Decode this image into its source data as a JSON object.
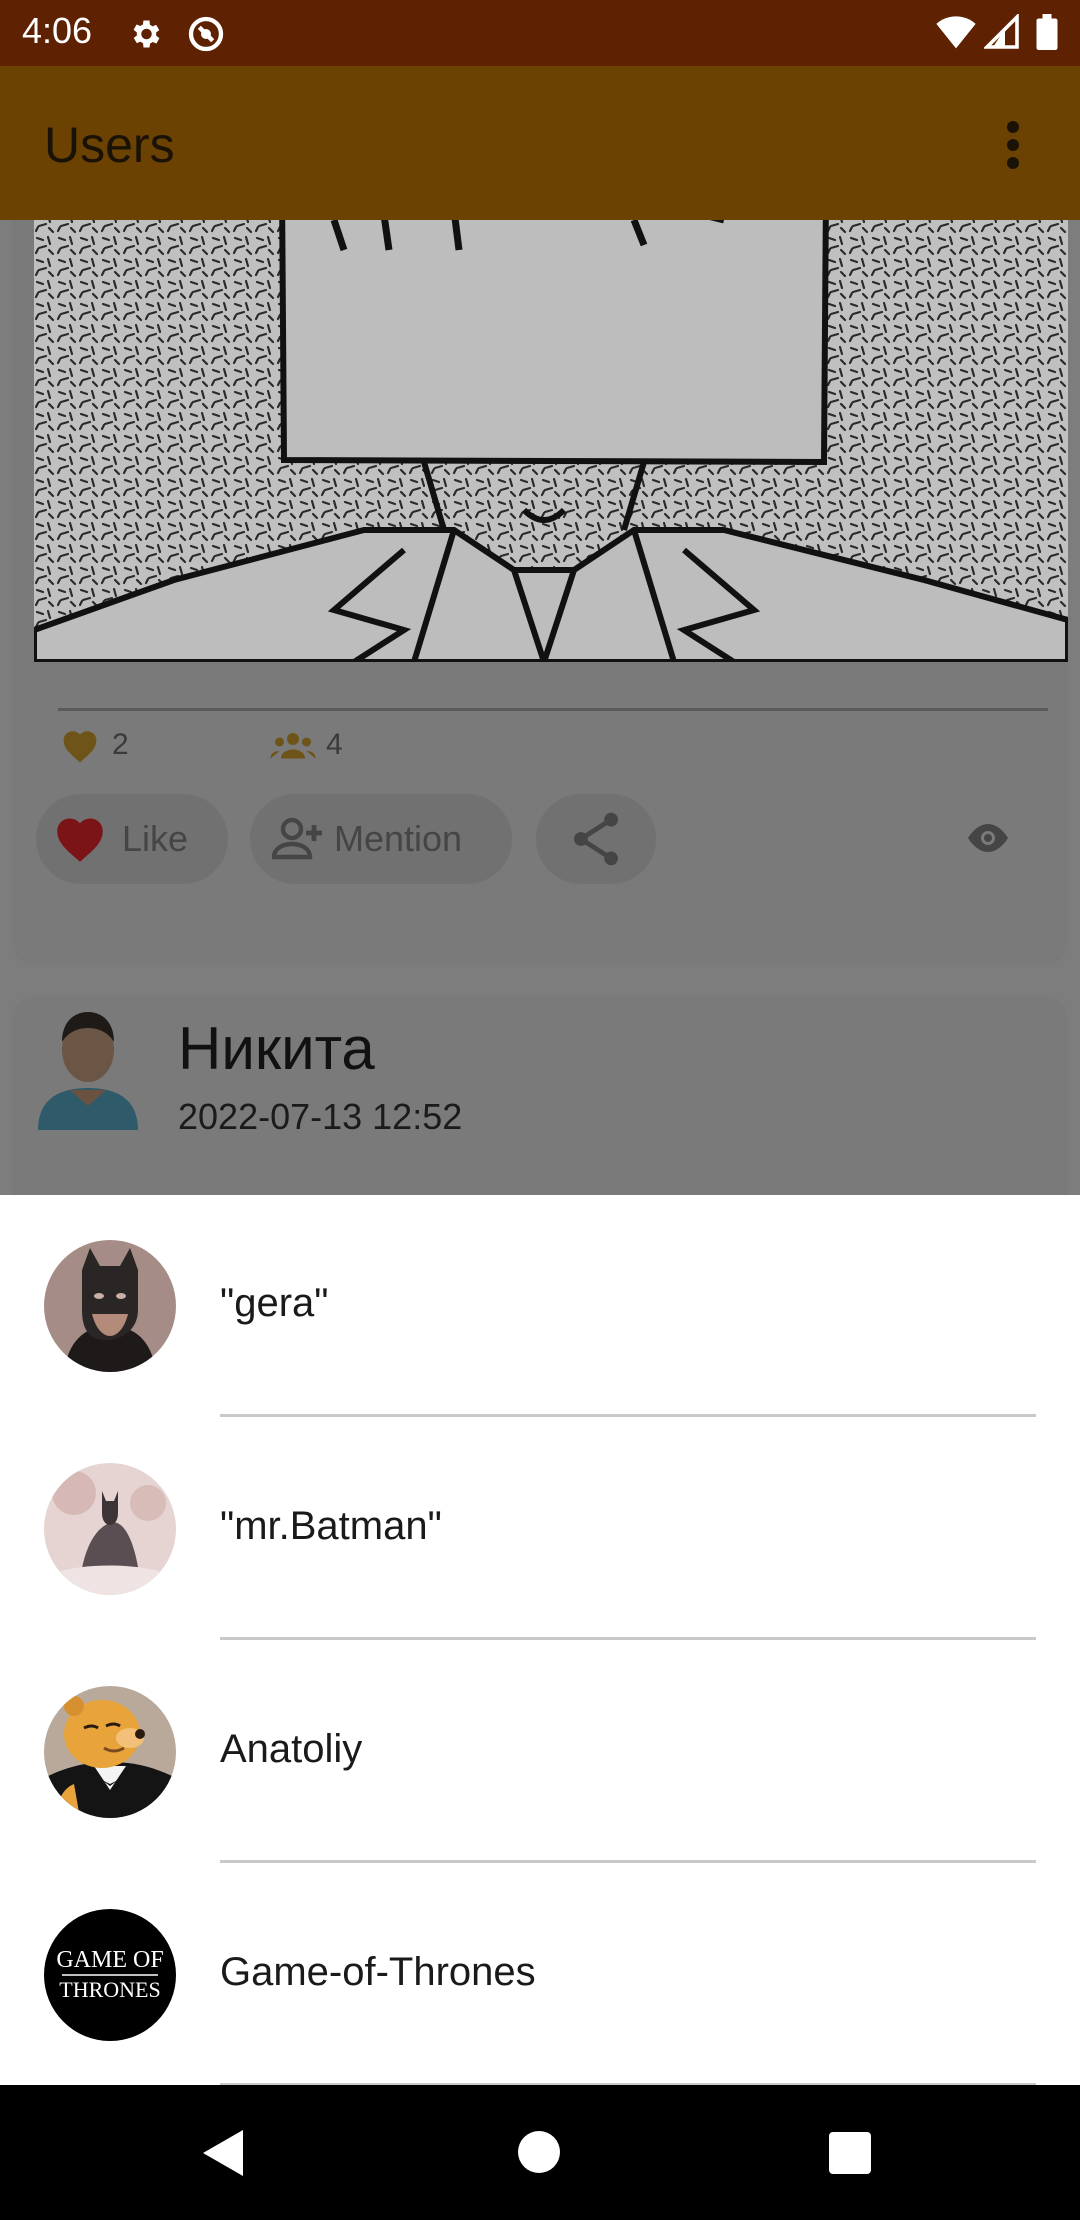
{
  "status_bar": {
    "time": "4:06",
    "icons": [
      "gear-icon",
      "vpn-icon",
      "wifi-icon",
      "signal-icon",
      "battery-icon"
    ],
    "background": "#5e2202"
  },
  "app_bar": {
    "title": "Users",
    "menu_icon": "more-vert-icon",
    "background": "#6b4202"
  },
  "post": {
    "stats": {
      "likes": "2",
      "mentions": "4"
    },
    "actions": {
      "like_label": "Like",
      "mention_label": "Mention",
      "share_icon": "share-icon",
      "view_icon": "eye-icon"
    }
  },
  "user_card": {
    "name": "Никита",
    "date": "2022-07-13 12:52"
  },
  "sheet": {
    "items": [
      {
        "name": "\"gera\"",
        "avatar": "batman-mask-avatar"
      },
      {
        "name": "\"mr.Batman\"",
        "avatar": "batman-figure-avatar"
      },
      {
        "name": "Anatoliy",
        "avatar": "pooh-tuxedo-avatar"
      },
      {
        "name": "Game-of-Thrones",
        "avatar": "game-of-thrones-logo-avatar",
        "logo_text": [
          "GAME OF",
          "THRONES"
        ]
      }
    ]
  },
  "nav_bar": {
    "icons": [
      "back-icon",
      "home-icon",
      "recents-icon"
    ]
  },
  "colors": {
    "accent_heart": "#7a1416",
    "dim_overlay": "#7d7d7d"
  }
}
